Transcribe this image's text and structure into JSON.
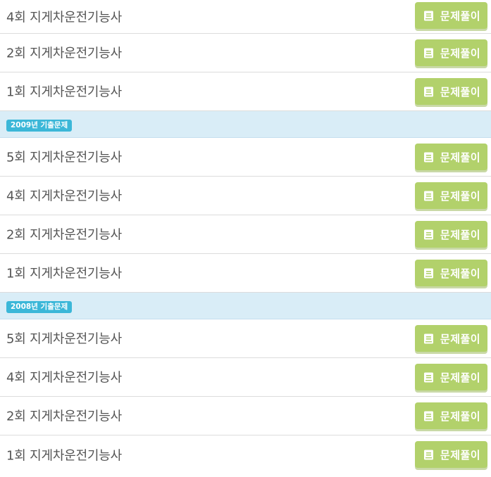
{
  "button_label": "문제풀이",
  "button_icon": "book-icon",
  "colors": {
    "button_bg": "#b2d16b",
    "section_bg": "#d9edf7",
    "badge_bg": "#3bb7d8",
    "text": "#555555"
  },
  "rows_top": [
    {
      "title": "4회 지게차운전기능사"
    },
    {
      "title": "2회 지게차운전기능사"
    },
    {
      "title": "1회 지게차운전기능사"
    }
  ],
  "sections": [
    {
      "badge": "2009년 기출문제",
      "rows": [
        {
          "title": "5회 지게차운전기능사"
        },
        {
          "title": "4회 지게차운전기능사"
        },
        {
          "title": "2회 지게차운전기능사"
        },
        {
          "title": "1회 지게차운전기능사"
        }
      ]
    },
    {
      "badge": "2008년 기출문제",
      "rows": [
        {
          "title": "5회 지게차운전기능사"
        },
        {
          "title": "4회 지게차운전기능사"
        },
        {
          "title": "2회 지게차운전기능사"
        },
        {
          "title": "1회 지게차운전기능사"
        }
      ]
    }
  ]
}
